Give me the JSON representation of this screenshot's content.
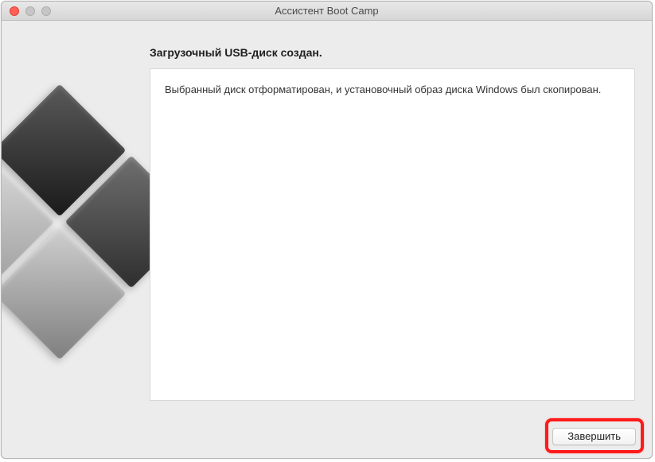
{
  "window": {
    "title": "Ассистент Boot Camp"
  },
  "main": {
    "heading": "Загрузочный USB-диск создан.",
    "body": "Выбранный диск отформатирован, и установочный образ диска Windows был скопирован."
  },
  "buttons": {
    "finish": "Завершить"
  }
}
